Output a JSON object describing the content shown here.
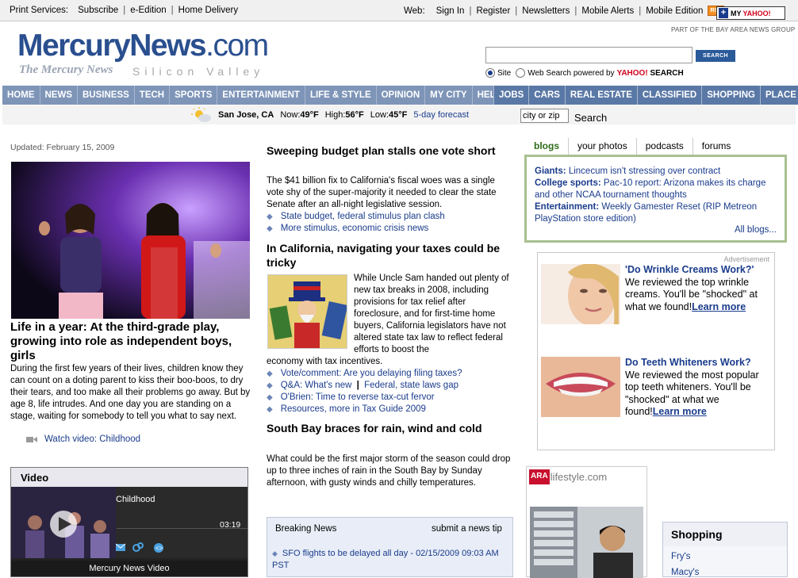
{
  "topbar": {
    "print_label": "Print Services:",
    "print_links": [
      "Subscribe",
      "e-Edition",
      "Home Delivery"
    ],
    "web_label": "Web:",
    "web_links": [
      "Sign In",
      "Register",
      "Newsletters",
      "Mobile Alerts",
      "Mobile Edition"
    ],
    "rss_label": "RSS",
    "myyahoo_label": "MY",
    "myyahoo_brand": "YAHOO!"
  },
  "header": {
    "logo_main": "MercuryNews",
    "logo_suffix": ".com",
    "logo_sub": "The Mercury News",
    "logo_region": "Silicon Valley",
    "part_of": "PART OF THE BAY AREA NEWS GROUP",
    "search_button": "SEARCH",
    "radio_site": "Site",
    "radio_web": "Web Search powered by",
    "yahoo": "YAHOO!",
    "search_word": "SEARCH"
  },
  "nav": {
    "left": [
      "HOME",
      "NEWS",
      "BUSINESS",
      "TECH",
      "SPORTS",
      "ENTERTAINMENT",
      "LIFE & STYLE",
      "OPINION",
      "MY CITY",
      "HELP"
    ],
    "right": [
      "JOBS",
      "CARS",
      "REAL ESTATE",
      "CLASSIFIED",
      "SHOPPING",
      "PLACE AD"
    ]
  },
  "weather": {
    "city": "San Jose, CA",
    "now_label": "Now:",
    "now": "49°F",
    "high_label": "High:",
    "high": "56°F",
    "low_label": "Low:",
    "low": "45°F",
    "forecast_link": "5-day forecast",
    "zip_placeholder": "city or zip",
    "search_label": "Search"
  },
  "left": {
    "updated": "Updated: February 15, 2009",
    "headline": "Life in a year: At the third-grade play, growing into role as independent boys, girls",
    "body": "During the first few years of their lives, children know they can count on a doting parent to kiss their boo-boos, to dry their tears, and too make all their problems go away. But by age 8, life intrudes. And one day you are standing on a stage, waiting for somebody to tell you what to say next.",
    "watch_video": "Watch video: Childhood",
    "video_box_title": "Video",
    "video_title": "Childhood",
    "video_duration": "03:19",
    "video_footer": "Mercury News Video"
  },
  "center": {
    "story1_headline": "Sweeping budget plan stalls one vote short",
    "story1_body": "The $41 billion fix to California's fiscal woes was a single vote shy of the super-majority it needed to clear the state Senate after an all-night legislative session.",
    "story1_links": [
      "State budget, federal stimulus plan clash",
      "More stimulus, economic crisis news"
    ],
    "story2_headline": "In California, navigating your taxes could be tricky",
    "story2_body": "While Uncle Sam handed out plenty of new tax breaks in 2008, including provisions for tax relief after foreclosure, and for first-time home buyers, California legislators have not altered state tax law to reflect federal efforts to boost the",
    "story2_body_cont": "economy with tax incentives.",
    "story2_links": [
      "Vote/comment: Are you delaying filing taxes?",
      "Q&A: What's new",
      "Federal, state laws gap",
      "O'Brien: Time to reverse tax-cut fervor",
      "Resources, more in Tax Guide 2009"
    ],
    "story3_headline": "South Bay braces for rain, wind and cold",
    "story3_body": "What could be the first major storm of the season could drop up to three inches of rain in the South Bay by Sunday afternoon, with gusty winds and chilly temperatures.",
    "breaking_title": "Breaking News",
    "breaking_tip": "submit a news tip",
    "breaking_item": "SFO flights to be delayed all day - 02/15/2009 09:03 AM PST"
  },
  "right": {
    "tabs": [
      "blogs",
      "your photos",
      "podcasts",
      "forums"
    ],
    "blogs": [
      {
        "cat": "Giants:",
        "text": "Lincecum isn't stressing over contract"
      },
      {
        "cat": "College sports:",
        "text": "Pac-10 report: Arizona makes its charge and other NCAA tournament thoughts"
      },
      {
        "cat": "Entertainment:",
        "text": "Weekly Gamester Reset (RIP Metreon PlayStation store edition)"
      }
    ],
    "all_blogs": "All blogs...",
    "ad_label": "Advertisement",
    "ad1_title": "'Do Wrinkle Creams Work?'",
    "ad1_body": "We reviewed the top wrinkle creams. You'll be \"shocked\" at what we found!",
    "ad1_link": "Learn more",
    "ad2_title": "Do Teeth Whiteners Work?",
    "ad2_body": "We reviewed the most popular top teeth whiteners. You'll be \"shocked\" at what we found!",
    "ad2_link": "Learn more",
    "ara_brand": "ARA",
    "ara_suffix": "lifestyle.com",
    "shopping_title": "Shopping",
    "shopping_links": [
      "Fry's",
      "Macy's"
    ]
  }
}
